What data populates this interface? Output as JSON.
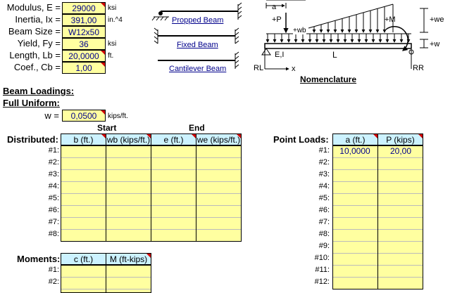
{
  "props": [
    {
      "label": "Modulus, E =",
      "value": "29000",
      "unit": "ksi"
    },
    {
      "label": "Inertia, Ix =",
      "value": "391,00",
      "unit": "in.^4"
    },
    {
      "label": "Beam Size =",
      "value": "W12x50",
      "unit": ""
    },
    {
      "label": "Yield, Fy =",
      "value": "36",
      "unit": "ksi"
    },
    {
      "label": "Length, Lb =",
      "value": "20,0000",
      "unit": "ft."
    },
    {
      "label": "Coef., Cb =",
      "value": "1,00",
      "unit": ""
    }
  ],
  "beam_links": [
    "Propped Beam",
    "Fixed Beam",
    "Cantilever Beam"
  ],
  "diagram": {
    "a": "a",
    "plus_P": "+P",
    "plus_M": "+M",
    "plus_we": "+we",
    "plus_wb": "+wb",
    "plus_w": "+w",
    "EI": "E,I",
    "L": "L",
    "RL": "RL",
    "RR": "RR",
    "x": "x",
    "caption": "Nomenclature"
  },
  "beam_loadings_title": "Beam Loadings:",
  "full_uniform": {
    "title": "Full Uniform:",
    "label": "w =",
    "value": "0,0500",
    "unit": "kips/ft."
  },
  "distributed": {
    "title": "Distributed:",
    "start_label": "Start",
    "end_label": "End",
    "headers": [
      "b (ft.)",
      "wb (kips/ft.)",
      "e (ft.)",
      "we (kips/ft.)"
    ],
    "rows": [
      "#1:",
      "#2:",
      "#3:",
      "#4:",
      "#5:",
      "#6:",
      "#7:",
      "#8:"
    ]
  },
  "point_loads": {
    "title": "Point Loads:",
    "headers": [
      "a (ft.)",
      "P (kips)"
    ],
    "rows": [
      "#1:",
      "#2:",
      "#3:",
      "#4:",
      "#5:",
      "#6:",
      "#7:",
      "#8:",
      "#9:",
      "#10:",
      "#11:",
      "#12:"
    ],
    "row1": [
      "10,0000",
      "20,00"
    ]
  },
  "moments": {
    "title": "Moments:",
    "headers": [
      "c (ft.)",
      "M (ft-kips)"
    ],
    "rows": [
      "#1:",
      "#2:"
    ]
  }
}
